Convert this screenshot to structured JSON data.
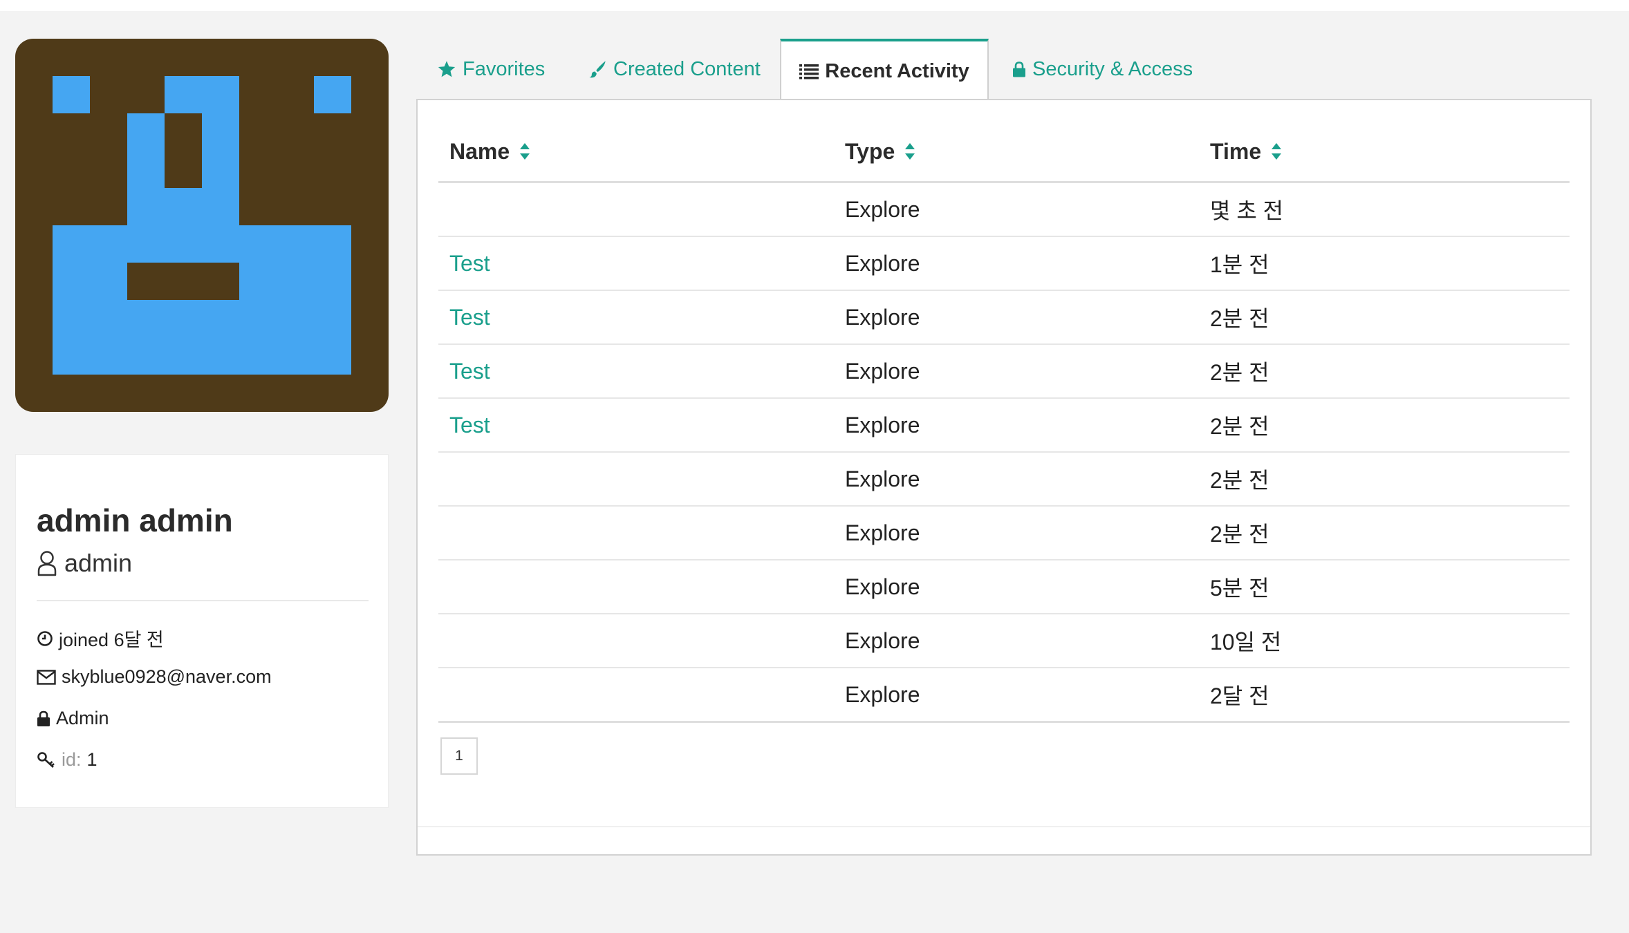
{
  "profile": {
    "name": "admin admin",
    "username": "admin",
    "joined": "joined 6달 전",
    "email": "skyblue0928@naver.com",
    "role": "Admin",
    "id_label": "id:",
    "id_value": "1"
  },
  "tabs": [
    {
      "label": "Favorites",
      "icon": "star-icon"
    },
    {
      "label": "Created Content",
      "icon": "brush-icon"
    },
    {
      "label": "Recent Activity",
      "icon": "list-icon",
      "active": true
    },
    {
      "label": "Security & Access",
      "icon": "lock-icon"
    }
  ],
  "activity": {
    "columns": [
      "Name",
      "Type",
      "Time"
    ],
    "rows": [
      {
        "name": "",
        "type": "Explore",
        "time": "몇 초 전"
      },
      {
        "name": "Test",
        "type": "Explore",
        "time": "1분 전"
      },
      {
        "name": "Test",
        "type": "Explore",
        "time": "2분 전"
      },
      {
        "name": "Test",
        "type": "Explore",
        "time": "2분 전"
      },
      {
        "name": "Test",
        "type": "Explore",
        "time": "2분 전"
      },
      {
        "name": "",
        "type": "Explore",
        "time": "2분 전"
      },
      {
        "name": "",
        "type": "Explore",
        "time": "2분 전"
      },
      {
        "name": "",
        "type": "Explore",
        "time": "5분 전"
      },
      {
        "name": "",
        "type": "Explore",
        "time": "10일 전"
      },
      {
        "name": "",
        "type": "Explore",
        "time": "2달 전"
      }
    ]
  },
  "pagination": {
    "current": "1"
  },
  "colors": {
    "accent": "#1a9f8c",
    "avatar_background": "#4f3a18",
    "avatar_foreground": "#45a6f2"
  }
}
